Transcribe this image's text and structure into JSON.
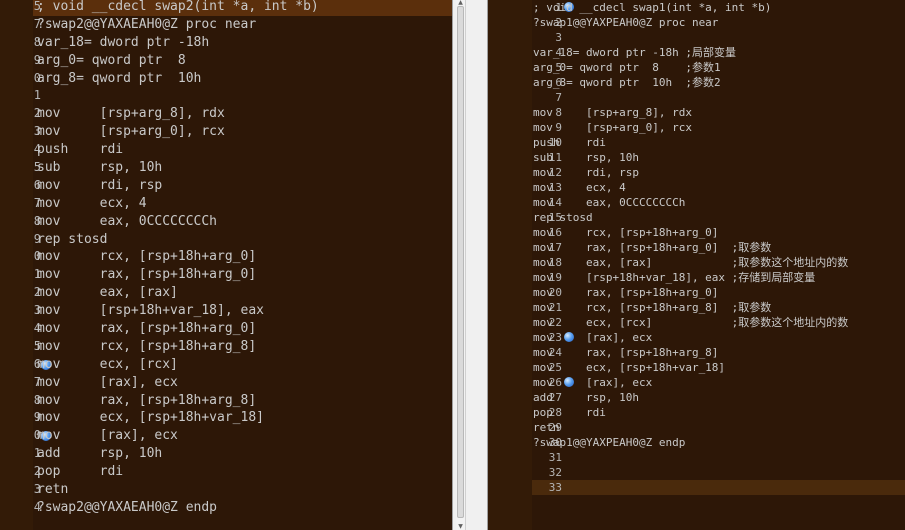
{
  "left_pane": {
    "lines": [
      {
        "num": "5",
        "text": "; void __cdecl swap2(int *a, int *b)",
        "highlight": true
      },
      {
        "num": "7",
        "text": "?swap2@@YAXAEAH0@Z proc near"
      },
      {
        "num": "8",
        "text": "var_18= dword ptr -18h"
      },
      {
        "num": "9",
        "text": "arg_0= qword ptr  8"
      },
      {
        "num": "0",
        "text": "arg_8= qword ptr  10h"
      },
      {
        "num": "1",
        "text": ""
      },
      {
        "num": "2",
        "text": "mov     [rsp+arg_8], rdx"
      },
      {
        "num": "3",
        "text": "mov     [rsp+arg_0], rcx"
      },
      {
        "num": "4",
        "text": "push    rdi"
      },
      {
        "num": "5",
        "text": "sub     rsp, 10h"
      },
      {
        "num": "6",
        "text": "mov     rdi, rsp"
      },
      {
        "num": "7",
        "text": "mov     ecx, 4"
      },
      {
        "num": "8",
        "text": "mov     eax, 0CCCCCCCCh"
      },
      {
        "num": "9",
        "text": "rep stosd"
      },
      {
        "num": "0",
        "text": "mov     rcx, [rsp+18h+arg_0]"
      },
      {
        "num": "1",
        "text": "mov     rax, [rsp+18h+arg_0]"
      },
      {
        "num": "2",
        "text": "mov     eax, [rax]"
      },
      {
        "num": "3",
        "text": "mov     [rsp+18h+var_18], eax"
      },
      {
        "num": "4",
        "text": "mov     rax, [rsp+18h+arg_0]"
      },
      {
        "num": "5",
        "text": "mov     rcx, [rsp+18h+arg_8]"
      },
      {
        "num": "6",
        "text": "mov     ecx, [rcx]",
        "breakpoint": true
      },
      {
        "num": "7",
        "text": "mov     [rax], ecx"
      },
      {
        "num": "8",
        "text": "mov     rax, [rsp+18h+arg_8]"
      },
      {
        "num": "9",
        "text": "mov     ecx, [rsp+18h+var_18]"
      },
      {
        "num": "0",
        "text": "mov     [rax], ecx",
        "breakpoint": true
      },
      {
        "num": "1",
        "text": "add     rsp, 10h"
      },
      {
        "num": "2",
        "text": "pop     rdi"
      },
      {
        "num": "3",
        "text": "retn"
      },
      {
        "num": "4",
        "text": "?swap2@@YAXAEAH0@Z endp"
      }
    ]
  },
  "right_pane": {
    "lines": [
      {
        "num": "1",
        "text": "; void __cdecl swap1(int *a, int *b)",
        "breakpoint": true
      },
      {
        "num": "2",
        "text": "?swap1@@YAXPEAH0@Z proc near"
      },
      {
        "num": "3",
        "text": ""
      },
      {
        "num": "4",
        "text": "var_18= dword ptr -18h ;局部变量"
      },
      {
        "num": "5",
        "text": "arg_0= qword ptr  8    ;参数1"
      },
      {
        "num": "6",
        "text": "arg_8= qword ptr  10h  ;参数2"
      },
      {
        "num": "7",
        "text": ""
      },
      {
        "num": "8",
        "text": "mov     [rsp+arg_8], rdx"
      },
      {
        "num": "9",
        "text": "mov     [rsp+arg_0], rcx"
      },
      {
        "num": "10",
        "text": "push    rdi"
      },
      {
        "num": "11",
        "text": "sub     rsp, 10h"
      },
      {
        "num": "12",
        "text": "mov     rdi, rsp"
      },
      {
        "num": "13",
        "text": "mov     ecx, 4"
      },
      {
        "num": "14",
        "text": "mov     eax, 0CCCCCCCCh"
      },
      {
        "num": "15",
        "text": "rep stosd"
      },
      {
        "num": "16",
        "text": "mov     rcx, [rsp+18h+arg_0]"
      },
      {
        "num": "17",
        "text": "mov     rax, [rsp+18h+arg_0]  ;取参数"
      },
      {
        "num": "18",
        "text": "mov     eax, [rax]            ;取参数这个地址内的数"
      },
      {
        "num": "19",
        "text": "mov     [rsp+18h+var_18], eax ;存储到局部变量"
      },
      {
        "num": "20",
        "text": "mov     rax, [rsp+18h+arg_0]"
      },
      {
        "num": "21",
        "text": "mov     rcx, [rsp+18h+arg_8]  ;取参数"
      },
      {
        "num": "22",
        "text": "mov     ecx, [rcx]            ;取参数这个地址内的数"
      },
      {
        "num": "23",
        "text": "mov     [rax], ecx",
        "breakpoint": true
      },
      {
        "num": "24",
        "text": "mov     rax, [rsp+18h+arg_8]"
      },
      {
        "num": "25",
        "text": "mov     ecx, [rsp+18h+var_18]"
      },
      {
        "num": "26",
        "text": "mov     [rax], ecx",
        "breakpoint": true
      },
      {
        "num": "27",
        "text": "add     rsp, 10h"
      },
      {
        "num": "28",
        "text": "pop     rdi"
      },
      {
        "num": "29",
        "text": "retn"
      },
      {
        "num": "30",
        "text": "?swap1@@YAXPEAH0@Z endp"
      },
      {
        "num": "31",
        "text": ""
      },
      {
        "num": "32",
        "text": ""
      },
      {
        "num": "33",
        "text": "",
        "current": true
      }
    ]
  },
  "colors": {
    "background": "#2d1707",
    "gutter": "#331b07",
    "text": "#c9c9c9",
    "line_highlight": "#5b2f0c",
    "breakpoint": "#3c7fe0"
  }
}
